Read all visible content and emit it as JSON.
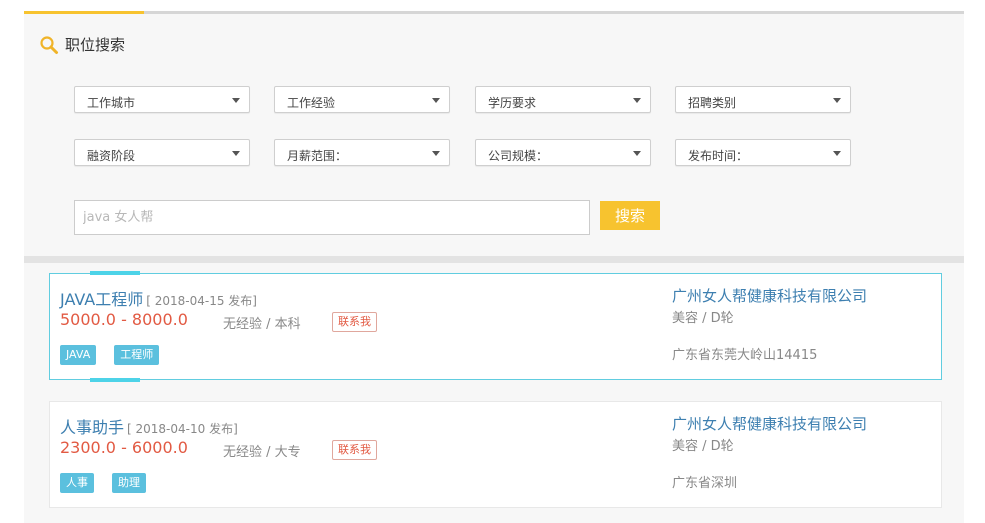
{
  "search": {
    "title": "职位搜索",
    "filters_row1": [
      "工作城市",
      "工作经验",
      "学历要求",
      "招聘类别"
    ],
    "filters_row2": [
      "融资阶段",
      "月薪范围：",
      "公司规模：",
      "发布时间："
    ],
    "input_placeholder": "java 女人帮",
    "button_label": "搜索"
  },
  "jobs": [
    {
      "title": "JAVA工程师",
      "date": "[ 2018-04-15 发布]",
      "salary": "5000.0 - 8000.0",
      "requirements": "无经验 / 本科",
      "contact_label": "联系我",
      "tags": [
        "JAVA",
        "工程师"
      ],
      "company": "广州女人帮健康科技有限公司",
      "company_meta": "美容 / D轮",
      "address": "广东省东莞大岭山14415",
      "active": true
    },
    {
      "title": "人事助手",
      "date": "[ 2018-04-10 发布]",
      "salary": "2300.0 - 6000.0",
      "requirements": "无经验 / 大专",
      "contact_label": "联系我",
      "tags": [
        "人事",
        "助理"
      ],
      "company": "广州女人帮健康科技有限公司",
      "company_meta": "美容 / D轮",
      "address": "广东省深圳",
      "active": false
    }
  ],
  "colors": {
    "accent": "#f7c32f",
    "link": "#3d7fb0",
    "salary": "#e25a43",
    "tag": "#5bc0de",
    "active_border": "#61cde0"
  }
}
